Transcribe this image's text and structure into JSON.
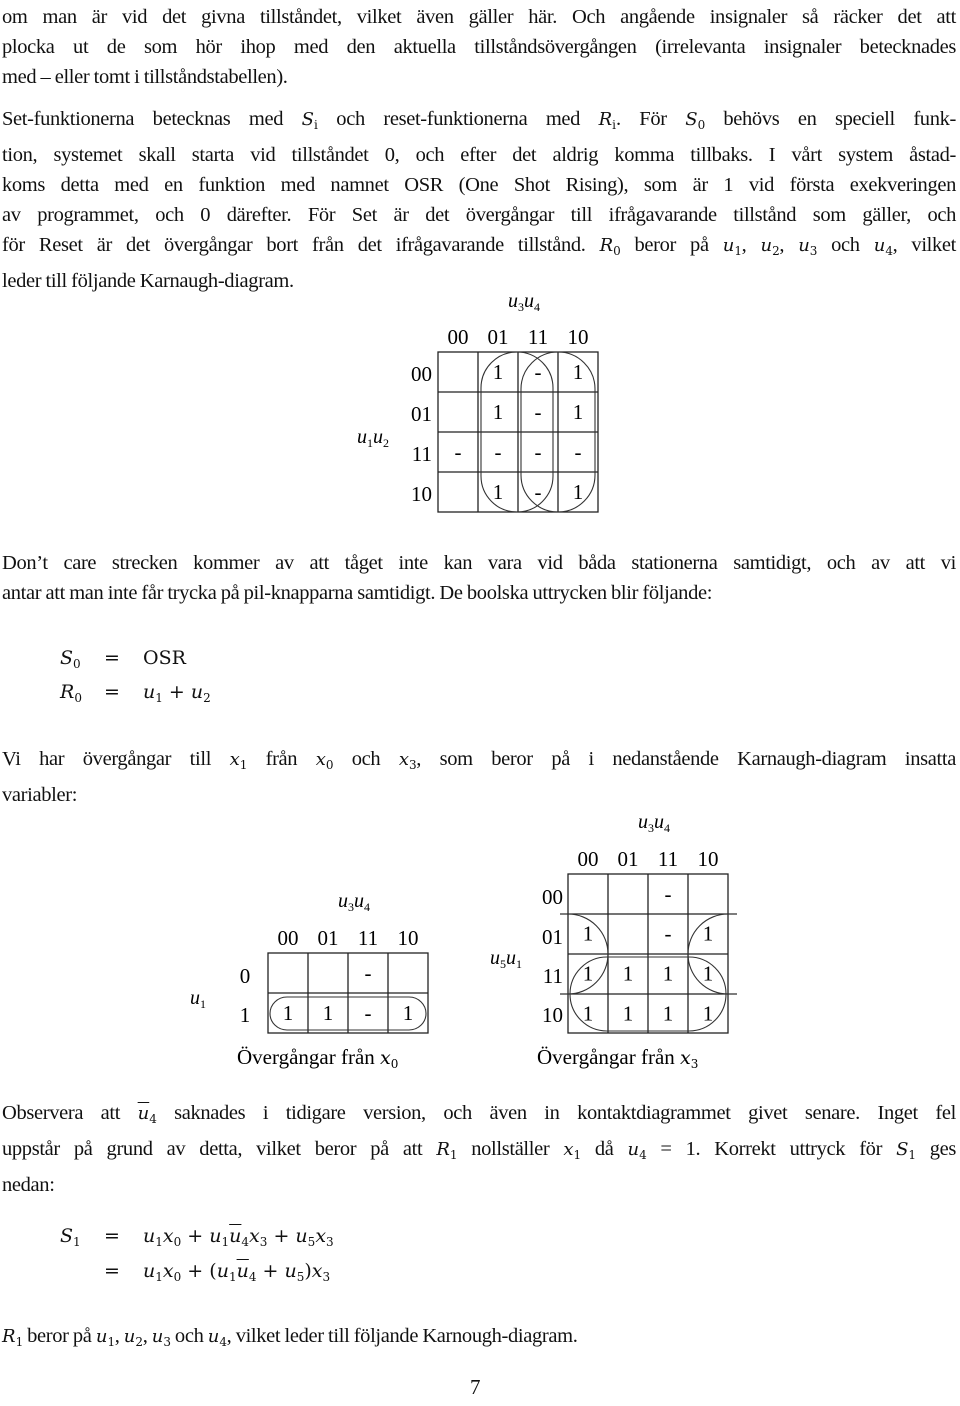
{
  "paragraphs": {
    "p1": [
      "om man är vid det givna tillståndet, vilket även gäller här. Och angående insignaler så räcker det att",
      "plocka ut de som hör ihop med den aktuella tillståndsövergången (irrelevanta insignaler betecknades",
      "med – eller tomt i tillståndstabellen)."
    ],
    "p2": {
      "l1a": "Set-funktionerna betecknas med ",
      "l1b": " och reset-funktionerna med ",
      "l1c": ". För ",
      "l1d": " behövs en speciell funk-",
      "l2": "tion, systemet skall starta vid tillståndet 0, och efter det aldrig komma tillbaks. I vårt system åstad-",
      "l3": "koms detta med en funktion med namnet OSR (One Shot Rising), som är 1 vid första exekveringen",
      "l4": "av programmet, och 0 därefter. För Set är det övergångar till ifrågavarande tillstånd som gäller, och",
      "l5a": "för Reset är det övergångar bort från det ifrågavarande tillstånd. ",
      "l5b": " beror på ",
      "l5c": ", ",
      "l5d": ", ",
      "l5e": " och ",
      "l5f": ", vilket",
      "l6": "leder till följande Karnaugh-diagram."
    },
    "p3": [
      "Don’t care strecken kommer av att tåget inte kan vara vid båda stationerna samtidigt, och av att vi",
      "antar att man inte får trycka på pil-knapparna samtidigt. De boolska uttrycken blir följande:"
    ],
    "p4": {
      "l1a": "Vi har övergångar till ",
      "l1b": " från ",
      "l1c": " och ",
      "l1d": ", som beror på i nedanstående Karnaugh-diagram insatta",
      "l2": "variabler:"
    },
    "p5": {
      "l1a": "Observera att ",
      "l1b": " saknades i tidigare version, och även in kontaktdiagrammet givet senare. Inget fel",
      "l2a": "uppstår på grund av detta, vilket beror på att ",
      "l2b": " nollställer ",
      "l2c": " då ",
      "l2d": " = 1. Korrekt uttryck för ",
      "l2e": " ges",
      "l3": "nedan:"
    },
    "p6": {
      "a": " beror på ",
      "b": ", ",
      "c": ", ",
      "d": " och ",
      "e": ", vilket leder till följande Karnough-diagram."
    }
  },
  "math": {
    "S": "S",
    "R": "R",
    "u": "u",
    "x": "x",
    "i": "i",
    "0": "0",
    "1": "1",
    "2": "2",
    "3": "3",
    "4": "4",
    "5": "5"
  },
  "equations1": {
    "rows": [
      {
        "lhs": "S",
        "lhs_sub": "0",
        "eq": "=",
        "rhs": "OSR"
      },
      {
        "lhs": "R",
        "lhs_sub": "0",
        "eq": "=",
        "rhs": "u₁ + u₂"
      }
    ]
  },
  "equations2": {
    "row1": {
      "lhs": "S",
      "lhs_sub": "1",
      "eq": "="
    },
    "row2": {
      "eq": "="
    },
    "plus": "+",
    "lparen": "(",
    "rparen": ")"
  },
  "kmaps": [
    {
      "title": "u3u4",
      "col_var": "u₃u₄",
      "row_var": "u₁u₂",
      "col_labels": [
        "00",
        "01",
        "11",
        "10"
      ],
      "row_labels": [
        "00",
        "01",
        "11",
        "10"
      ],
      "cells": [
        [
          "",
          "1",
          "-",
          "1"
        ],
        [
          "",
          "1",
          "-",
          "1"
        ],
        [
          "-",
          "-",
          "-",
          "-"
        ],
        [
          "",
          "1",
          "-",
          "1"
        ]
      ],
      "groups": [
        "columns 01+11",
        "columns 11+10"
      ]
    },
    {
      "title": "Övergångar från x0",
      "caption_text": "Övergångar från ",
      "caption_var": "x",
      "caption_sub": "0",
      "col_var": "u₃u₄",
      "row_var": "u₁",
      "col_labels": [
        "00",
        "01",
        "11",
        "10"
      ],
      "row_labels": [
        "0",
        "1"
      ],
      "cells": [
        [
          "",
          "",
          "-",
          ""
        ],
        [
          "1",
          "1",
          "-",
          "1"
        ]
      ],
      "groups": [
        "row 1"
      ]
    },
    {
      "title": "Övergångar från x3",
      "caption_text": "Övergångar från ",
      "caption_var": "x",
      "caption_sub": "3",
      "col_var": "u₃u₄",
      "row_var": "u₅u₁",
      "col_labels": [
        "00",
        "01",
        "11",
        "10"
      ],
      "row_labels": [
        "00",
        "01",
        "11",
        "10"
      ],
      "cells": [
        [
          "",
          "",
          "-",
          ""
        ],
        [
          "1",
          "",
          "-",
          "1"
        ],
        [
          "1",
          "1",
          "1",
          "1"
        ],
        [
          "1",
          "1",
          "1",
          "1"
        ]
      ],
      "groups": [
        "corners rows 01+11 cols 00+10 (wrap)",
        "rows 11+10"
      ]
    }
  ],
  "page_number": "7"
}
